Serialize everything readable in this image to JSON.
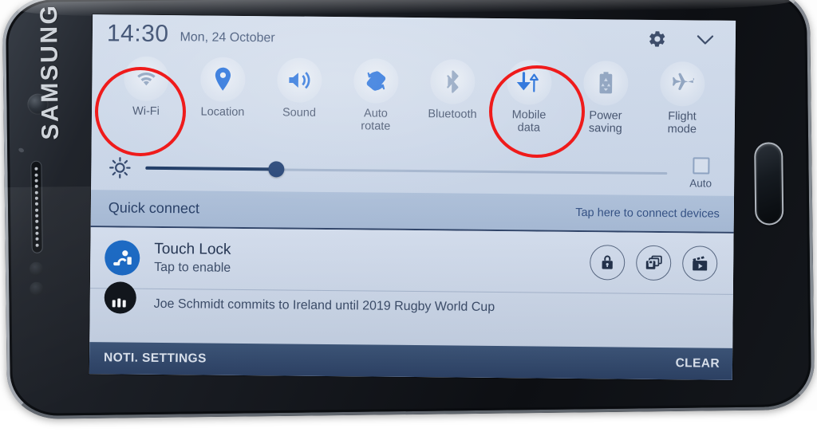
{
  "device": {
    "brand": "SAMSUNG",
    "hardware": {
      "front_camera": "front-camera",
      "earpiece_speaker": "earpiece-speaker",
      "proximity_sensor": "proximity-sensor",
      "home_button": "home-button"
    }
  },
  "statusbar": {
    "time": "14:30",
    "date": "Mon, 24 October",
    "settings_icon": "gear-icon",
    "collapse_icon": "chevron-down-icon"
  },
  "toggles": [
    {
      "label": "Wi-Fi",
      "icon": "wifi-icon",
      "state": "off"
    },
    {
      "label": "Location",
      "icon": "location-pin-icon",
      "state": "on"
    },
    {
      "label": "Sound",
      "icon": "speaker-icon",
      "state": "on"
    },
    {
      "label": "Auto\nrotate",
      "icon": "auto-rotate-icon",
      "state": "on"
    },
    {
      "label": "Bluetooth",
      "icon": "bluetooth-icon",
      "state": "off"
    },
    {
      "label": "Mobile\ndata",
      "icon": "mobile-data-icon",
      "state": "on"
    },
    {
      "label": "Power\nsaving",
      "icon": "power-saving-icon",
      "state": "off"
    },
    {
      "label": "Flight\nmode",
      "icon": "airplane-icon",
      "state": "off"
    }
  ],
  "brightness": {
    "icon": "brightness-sun-icon",
    "value_percent": 25,
    "auto_label": "Auto",
    "auto_checked": false
  },
  "quick_connect": {
    "title": "Quick connect",
    "hint": "Tap here to connect devices"
  },
  "notifications": [
    {
      "icon": "touch-lock-icon",
      "title": "Touch Lock",
      "subtitle": "Tap to enable",
      "actions": [
        {
          "icon": "padlock-icon"
        },
        {
          "icon": "screen-lock-icon"
        },
        {
          "icon": "video-clapper-icon"
        }
      ]
    },
    {
      "icon": "news-app-icon",
      "title": "Joe Schmidt commits to Ireland until 2019 Rugby World Cup"
    }
  ],
  "bottom_bar": {
    "settings_label": "NOTI. SETTINGS",
    "clear_label": "CLEAR"
  },
  "annotations": [
    {
      "target": "Wi-Fi",
      "shape": "circle",
      "color": "#ef1b1b"
    },
    {
      "target": "Mobile data",
      "shape": "circle",
      "color": "#ef1b1b"
    }
  ],
  "colors": {
    "accent_blue": "#1565d8",
    "panel_bg": "#cfdaea",
    "quick_connect_bg": "#a6b9d4",
    "bottom_bar_bg": "#33496c",
    "annotation_red": "#ef1b1b",
    "disabled_icon": "#8ba0bd"
  }
}
